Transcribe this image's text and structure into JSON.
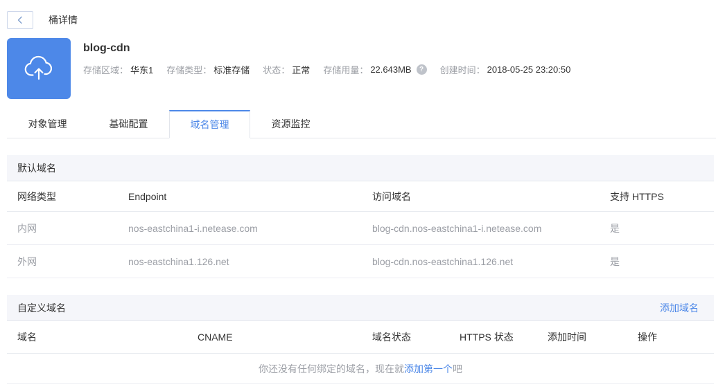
{
  "page": {
    "title": "桶详情"
  },
  "icons": {
    "help_glyph": "?"
  },
  "bucket": {
    "name": "blog-cdn",
    "info": [
      {
        "label": "存储区域：",
        "value": "华东1"
      },
      {
        "label": "存储类型：",
        "value": "标准存储"
      },
      {
        "label": "状态：",
        "value": "正常"
      },
      {
        "label": "存储用量：",
        "value": "22.643MB"
      },
      {
        "label": "创建时间：",
        "value": "2018-05-25 23:20:50"
      }
    ]
  },
  "tabs": [
    {
      "label": "对象管理",
      "active": false
    },
    {
      "label": "基础配置",
      "active": false
    },
    {
      "label": "域名管理",
      "active": true
    },
    {
      "label": "资源监控",
      "active": false
    }
  ],
  "default_domain": {
    "section_title": "默认域名",
    "columns": [
      "网络类型",
      "Endpoint",
      "访问域名",
      "支持 HTTPS"
    ],
    "rows": [
      [
        "内网",
        "nos-eastchina1-i.netease.com",
        "blog-cdn.nos-eastchina1-i.netease.com",
        "是"
      ],
      [
        "外网",
        "nos-eastchina1.126.net",
        "blog-cdn.nos-eastchina1.126.net",
        "是"
      ]
    ]
  },
  "custom_domain": {
    "section_title": "自定义域名",
    "add_link_label": "添加域名",
    "columns": [
      "域名",
      "CNAME",
      "域名状态",
      "HTTPS 状态",
      "添加时间",
      "操作"
    ],
    "empty_state": {
      "prefix": "你还没有任何绑定的域名，现在就",
      "link": "添加第一个",
      "suffix": "吧"
    }
  },
  "colors": {
    "accent_blue": "#4d88e8",
    "icon_background": "#4d88e8",
    "section_bar_background": "#f5f6fa",
    "muted_text": "#9b9ea5"
  }
}
